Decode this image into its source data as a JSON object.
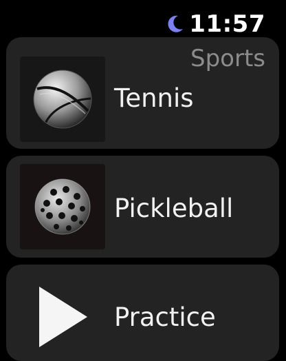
{
  "status": {
    "time": "11:57",
    "focus_icon": "moon-icon",
    "focus_color": "#7b7ff0"
  },
  "page": {
    "title": "Sports"
  },
  "sports": [
    {
      "label": "Tennis",
      "icon": "tennis-ball-icon"
    },
    {
      "label": "Pickleball",
      "icon": "pickleball-icon"
    },
    {
      "label": "Practice",
      "icon": "play-icon"
    }
  ]
}
